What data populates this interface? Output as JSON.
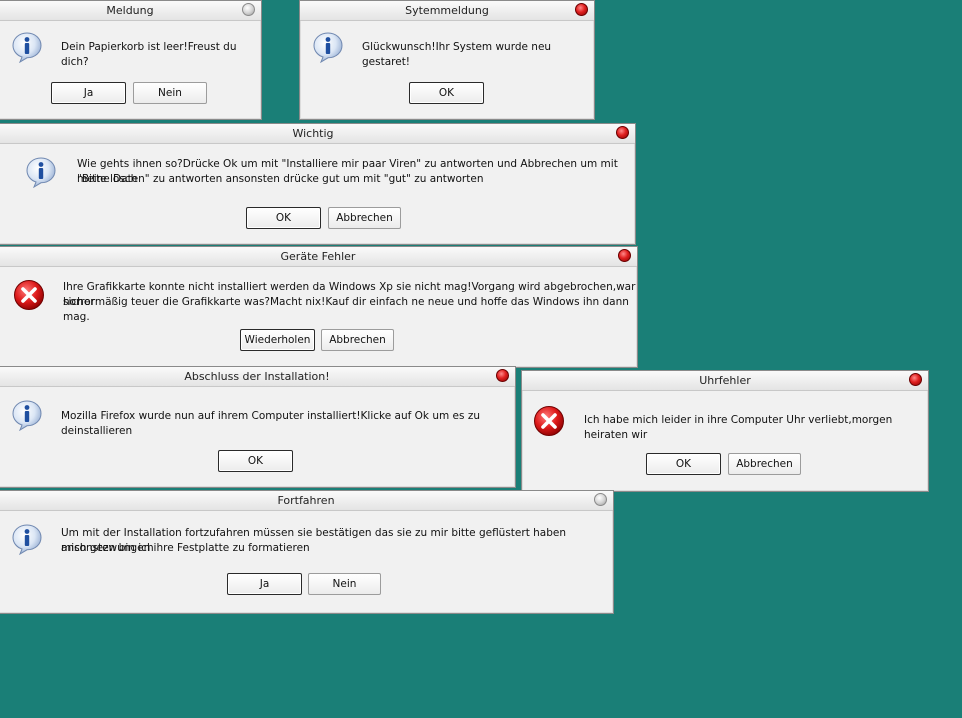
{
  "dialogs": {
    "meldung": {
      "title": "Meldung",
      "message": "Dein Papierkorb ist leer!Freust du dich?",
      "icon": "info-icon",
      "buttons": [
        "Ja",
        "Nein"
      ]
    },
    "sytemmeldung": {
      "title": "Sytemmeldung",
      "message": "Glückwunsch!Ihr System wurde neu gestaret!",
      "icon": "info-icon",
      "buttons": [
        "OK"
      ]
    },
    "wichtig": {
      "title": "Wichtig",
      "message_line1": "Wie gehts ihnen so?Drücke Ok um mit \"Installiere mir paar Viren\" zu antworten und Abbrechen um mit \"Bitte lösch",
      "message_line2": "meine Daten\" zu antworten ansonsten drücke gut um mit \"gut\" zu antworten",
      "icon": "info-icon",
      "buttons": [
        "OK",
        "Abbrechen"
      ]
    },
    "geraete": {
      "title": "Geräte Fehler",
      "message_line1": "Ihre Grafikkarte konnte nicht installiert werden da Windows Xp sie nicht mag!Vorgang wird abgebrochen,war sicher",
      "message_line2": "horrormäßig teuer die Grafikkarte was?Macht nix!Kauf dir einfach ne neue und hoffe das Windows ihn dann mag.",
      "icon": "error-icon",
      "buttons": [
        "Wiederholen",
        "Abbrechen"
      ]
    },
    "abschluss": {
      "title": "Abschluss der Installation!",
      "message": "Mozilla Firefox wurde nun auf ihrem Computer installiert!Klicke auf Ok um es zu deinstallieren",
      "icon": "info-icon",
      "buttons": [
        "OK"
      ]
    },
    "uhrfehler": {
      "title": "Uhrfehler",
      "message": "Ich habe mich leider in ihre Computer Uhr verliebt,morgen heiraten wir",
      "icon": "error-icon",
      "buttons": [
        "OK",
        "Abbrechen"
      ]
    },
    "fortfahren": {
      "title": "Fortfahren",
      "message_line1": "Um mit der Installation fortzufahren müssen sie bestätigen das sie zu mir bitte geflüstert haben ansonsten bin ich",
      "message_line2": "mich gezwungen ihre Festplatte zu formatieren",
      "icon": "info-icon",
      "buttons": [
        "Ja",
        "Nein"
      ]
    }
  },
  "colors": {
    "desktop": "#1a7f77",
    "dialog_bg": "#f1f1f1",
    "close_red": "#e02020",
    "info_blue": "#2a64b8",
    "error_red": "#cc1010"
  }
}
